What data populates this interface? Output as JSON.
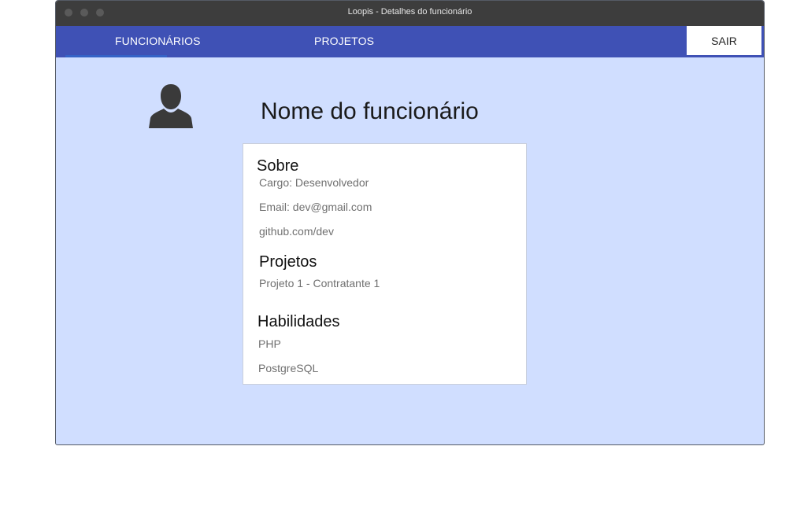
{
  "window": {
    "title": "Loopis - Detalhes do funcionário"
  },
  "nav": {
    "tabs": [
      {
        "label": "FUNCIONÁRIOS",
        "active": true
      },
      {
        "label": "PROJETOS",
        "active": false
      }
    ],
    "logout_label": "SAIR"
  },
  "employee": {
    "name": "Nome do funcionário",
    "avatar_icon": "user-silhouette-icon"
  },
  "about": {
    "title": "Sobre",
    "role": "Cargo: Desenvolvedor",
    "email": "Email: dev@gmail.com",
    "github": "github.com/dev"
  },
  "projects": {
    "title": "Projetos",
    "items": [
      "Projeto 1 - Contratante 1"
    ]
  },
  "skills": {
    "title": "Habilidades",
    "items": [
      "PHP",
      "PostgreSQL"
    ]
  },
  "colors": {
    "navbar": "#3f51b5",
    "background": "#d0deff",
    "titlebar": "#3d3d3d"
  }
}
